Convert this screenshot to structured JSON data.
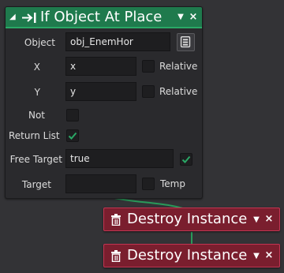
{
  "panel": {
    "title": "If Object At Place",
    "header_color": "#1f7a4d",
    "collapse_glyph": "◢",
    "menu_glyph": "▼",
    "close_glyph": "×",
    "fields": {
      "object": {
        "label": "Object",
        "value": "obj_EnemHor"
      },
      "x": {
        "label": "X",
        "value": "x",
        "relative_label": "Relative",
        "relative_checked": false
      },
      "y": {
        "label": "Y",
        "value": "y",
        "relative_label": "Relative",
        "relative_checked": false
      },
      "not": {
        "label": "Not",
        "checked": false
      },
      "return_list": {
        "label": "Return List",
        "checked": true
      },
      "free_target": {
        "label": "Free Target",
        "value": "true",
        "checked": true
      },
      "target": {
        "label": "Target",
        "value": "",
        "temp_label": "Temp",
        "temp_checked": false
      }
    }
  },
  "blocks": [
    {
      "title": "Destroy Instance",
      "menu_glyph": "▼",
      "close_glyph": "×",
      "color": "#7a1e2e"
    },
    {
      "title": "Destroy Instance",
      "menu_glyph": "▼",
      "close_glyph": "×",
      "color": "#7a1e2e"
    }
  ],
  "colors": {
    "check": "#2aa866",
    "wire": "#2a9a5a",
    "background": "#333336"
  },
  "icons": {
    "panel_icon": "arrow-to-bar-icon",
    "block_icon": "trash-can-icon",
    "picker_icon": "object-picker-icon"
  }
}
